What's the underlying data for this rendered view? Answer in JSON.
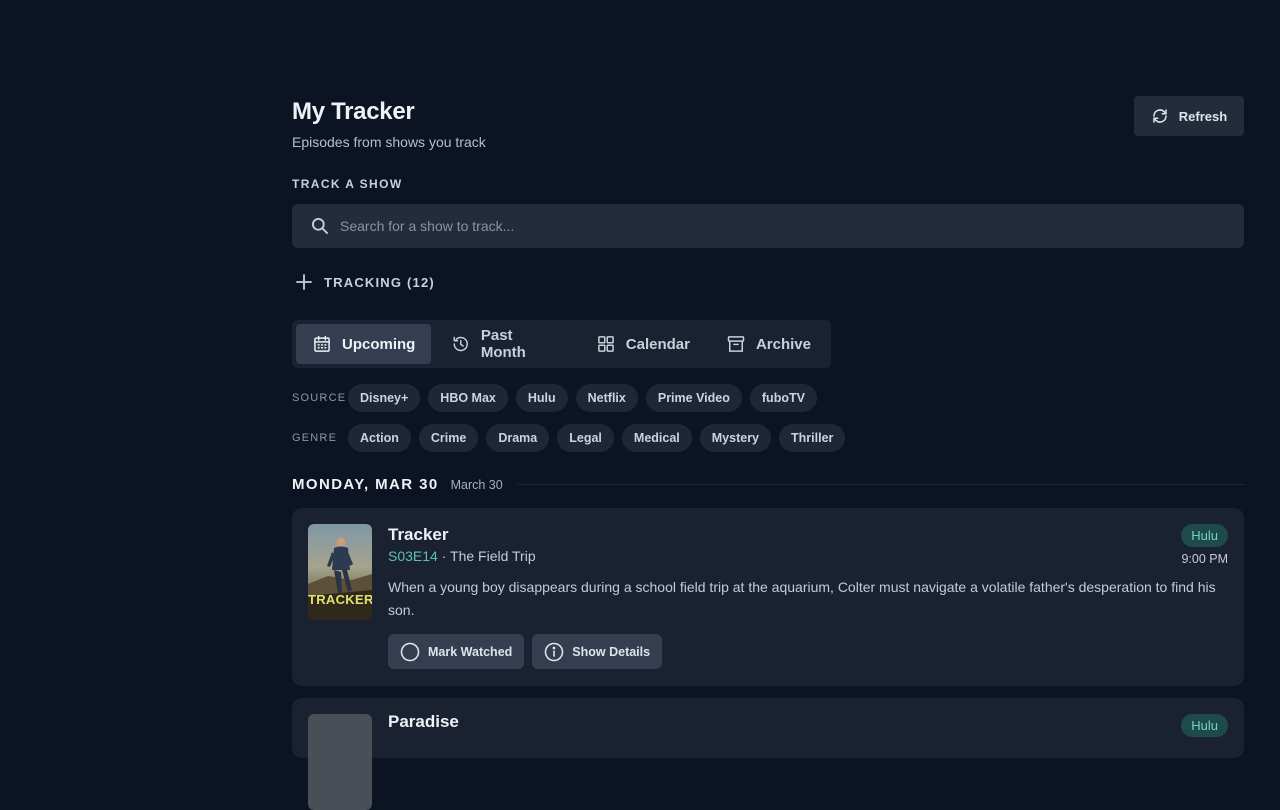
{
  "header": {
    "title": "My Tracker",
    "subtitle": "Episodes from shows you track",
    "refresh_label": "Refresh"
  },
  "track": {
    "section_label": "TRACK A SHOW",
    "search_placeholder": "Search for a show to track..."
  },
  "tracking": {
    "label": "TRACKING (12)"
  },
  "tabs": [
    {
      "label": "Upcoming",
      "icon": "calendar-icon",
      "active": true
    },
    {
      "label": "Past Month",
      "icon": "history-icon",
      "active": false
    },
    {
      "label": "Calendar",
      "icon": "grid-icon",
      "active": false
    },
    {
      "label": "Archive",
      "icon": "archive-icon",
      "active": false
    }
  ],
  "filters": {
    "source_label": "SOURCE",
    "sources": [
      "Disney+",
      "HBO Max",
      "Hulu",
      "Netflix",
      "Prime Video",
      "fuboTV"
    ],
    "genre_label": "GENRE",
    "genres": [
      "Action",
      "Crime",
      "Drama",
      "Legal",
      "Medical",
      "Mystery",
      "Thriller"
    ]
  },
  "day": {
    "title": "MONDAY, MAR 30",
    "date": "March 30"
  },
  "episodes": [
    {
      "show": "Tracker",
      "code": "S03E14",
      "separator": " · ",
      "episode_title": "The Field Trip",
      "description": "When a young boy disappears during a school field trip at the aquarium, Colter must navigate a volatile father's desperation to find his son.",
      "source": "Hulu",
      "time": "9:00 PM",
      "poster_text": "TRACKER",
      "actions": {
        "watched": "Mark Watched",
        "details": "Show Details"
      }
    },
    {
      "show": "Paradise",
      "source": "Hulu"
    }
  ],
  "colors": {
    "background": "#0c1424",
    "surface": "#1a2232",
    "accent_teal": "#5cc0b5",
    "badge_bg": "#1f4a4c"
  }
}
